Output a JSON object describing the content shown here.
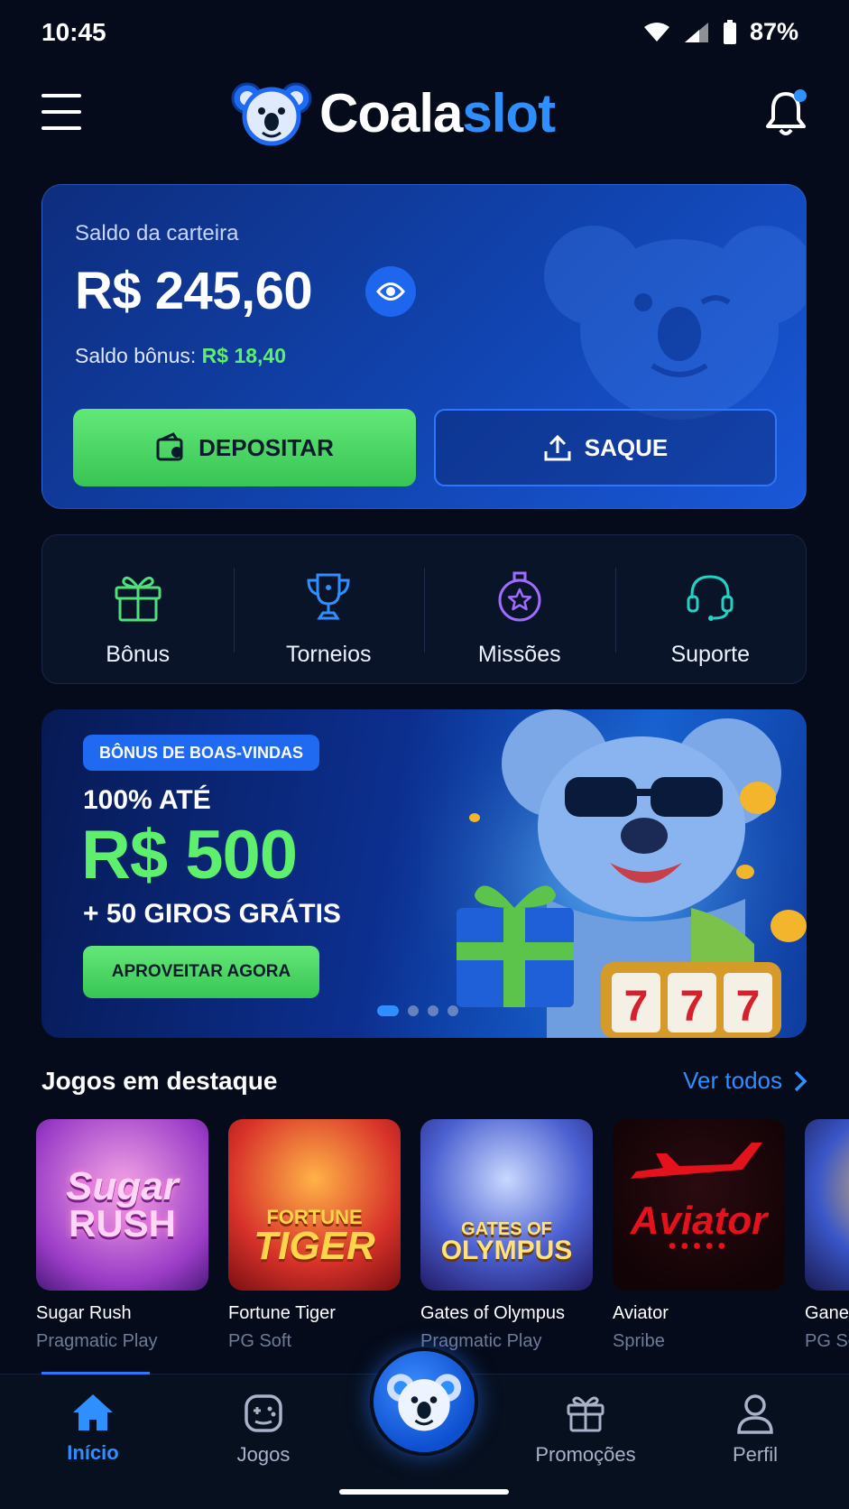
{
  "status": {
    "time": "10:45",
    "battery": "87%"
  },
  "header": {
    "logo_left": "Coala",
    "logo_right": "slot"
  },
  "wallet": {
    "label": "Saldo da carteira",
    "balance": "R$ 245,60",
    "bonus_label": "Saldo bônus:",
    "bonus_value": "R$ 18,40",
    "deposit_label": "DEPOSITAR",
    "withdraw_label": "SAQUE"
  },
  "quick_actions": [
    {
      "label": "Bônus",
      "icon": "gift-icon",
      "color": "#4ee07a"
    },
    {
      "label": "Torneios",
      "icon": "trophy-icon",
      "color": "#2f8fff"
    },
    {
      "label": "Missões",
      "icon": "medal-star-icon",
      "color": "#a06bff"
    },
    {
      "label": "Suporte",
      "icon": "headset-icon",
      "color": "#22d3c5"
    }
  ],
  "promo": {
    "badge": "BÔNUS DE BOAS-VINDAS",
    "line1": "100% ATÉ",
    "amount": "R$ 500",
    "line3": "+ 50 GIROS GRÁTIS",
    "cta": "APROVEITAR AGORA",
    "slides_total": 4,
    "active_slide": 1
  },
  "featured": {
    "title": "Jogos em destaque",
    "see_all": "Ver todos",
    "games": [
      {
        "name": "Sugar Rush",
        "provider": "Pragmatic Play",
        "art_text_1": "Sugar",
        "art_text_2": "RUSH"
      },
      {
        "name": "Fortune Tiger",
        "provider": "PG Soft",
        "art_text_1": "FORTUNE",
        "art_text_2": "TIGER"
      },
      {
        "name": "Gates of Olympus",
        "provider": "Pragmatic Play",
        "art_text_1": "GATES OF",
        "art_text_2": "OLYMPUS"
      },
      {
        "name": "Aviator",
        "provider": "Spribe",
        "art_text_1": "",
        "art_text_2": "Aviator"
      },
      {
        "name": "Ganesha",
        "provider": "PG Soft",
        "art_text_1": "",
        "art_text_2": ""
      }
    ]
  },
  "nav": {
    "home": "Início",
    "games": "Jogos",
    "promotions": "Promoções",
    "profile": "Perfil"
  },
  "colors": {
    "accent_blue": "#2f8fff",
    "accent_green": "#5ef06c",
    "background": "#050b1a"
  }
}
